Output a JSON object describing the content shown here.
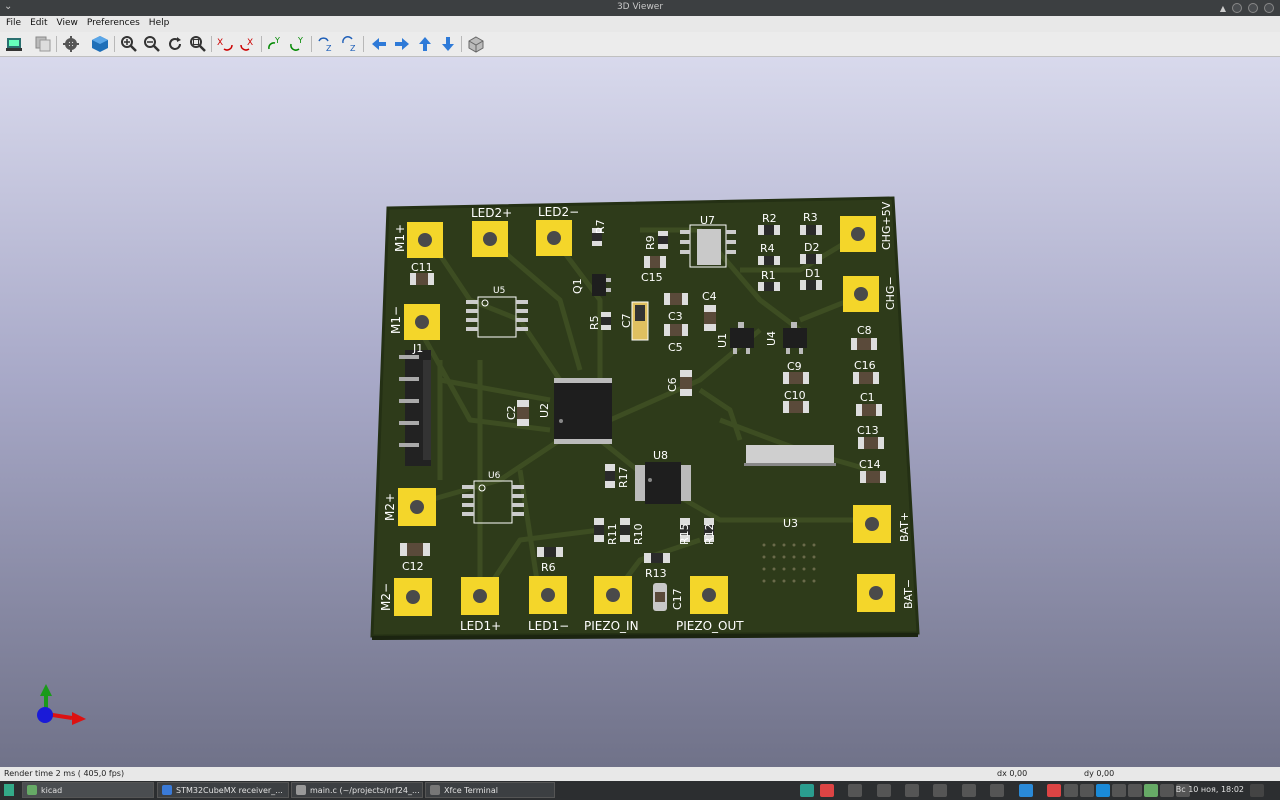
{
  "window": {
    "title": "3D Viewer",
    "menu_arrow": "⌄"
  },
  "menu": {
    "file": "File",
    "edit": "Edit",
    "view": "View",
    "preferences": "Preferences",
    "help": "Help"
  },
  "toolbar_icons": [
    "reload-board-icon",
    "copy-image-icon",
    "settings-gear-icon",
    "raytrace-cube-icon",
    "zoom-in-icon",
    "zoom-out-icon",
    "redraw-icon",
    "zoom-fit-icon",
    "rotate-x-cw-icon",
    "rotate-x-ccw-icon",
    "rotate-y-cw-icon",
    "rotate-y-ccw-icon",
    "rotate-z-cw-icon",
    "rotate-z-ccw-icon",
    "pan-left-icon",
    "pan-right-icon",
    "pan-up-icon",
    "pan-down-icon",
    "ortho-view-icon"
  ],
  "colors": {
    "board": "#2e3b1a",
    "pad": "#f4d62a",
    "silk": "#ffffff",
    "background_top": "#d8d9ec",
    "background_bottom": "#707289"
  },
  "board": {
    "labels": {
      "m1p": "M1+",
      "led2p": "LED2+",
      "led2m": "LED2−",
      "r7": "R7",
      "r9": "R9",
      "u7": "U7",
      "r2": "R2",
      "r3": "R3",
      "chg5": "CHG+5V",
      "c11": "C11",
      "c15": "C15",
      "r4": "R4",
      "d2": "D2",
      "r1": "R1",
      "d1": "D1",
      "chgm": "CHG−",
      "u5": "U5",
      "q1": "Q1",
      "c4": "C4",
      "m1m": "M1−",
      "r5": "R5",
      "c7": "C7",
      "c3": "C3",
      "c5": "C5",
      "u1": "U1",
      "u4": "U4",
      "c8": "C8",
      "j1": "J1",
      "c16": "C16",
      "c9": "C9",
      "c6": "C6",
      "c1": "C1",
      "c10": "C10",
      "c2": "C2",
      "u2": "U2",
      "c13": "C13",
      "u8": "U8",
      "c14": "C14",
      "r17": "R17",
      "u6": "U6",
      "m2p": "M2+",
      "batp": "BAT+",
      "u3": "U3",
      "r11": "R11",
      "r10": "R10",
      "r15": "R15",
      "r12": "R12",
      "c12": "C12",
      "r6": "R6",
      "r13": "R13",
      "c17": "C17",
      "m2m": "M2−",
      "led1p": "LED1+",
      "led1m": "LED1−",
      "piezo_in": "PIEZO_IN",
      "piezo_out": "PIEZO_OUT",
      "batm": "BAT−"
    }
  },
  "status": {
    "render_time": "Render time 2 ms ( 405,0 fps)",
    "dx": "dx 0,00",
    "dy": "dy 0,00"
  },
  "taskbar": {
    "tasks": [
      {
        "label": "kicad",
        "icon": "kicad-icon"
      },
      {
        "label": "STM32CubeMX receiver_...",
        "icon": "stm32-icon"
      },
      {
        "label": "main.c (~/projects/nrf24_...",
        "icon": "editor-icon"
      },
      {
        "label": "Xfce Terminal",
        "icon": "terminal-icon"
      }
    ],
    "clock": "Вс 10 ноя, 18:02"
  }
}
